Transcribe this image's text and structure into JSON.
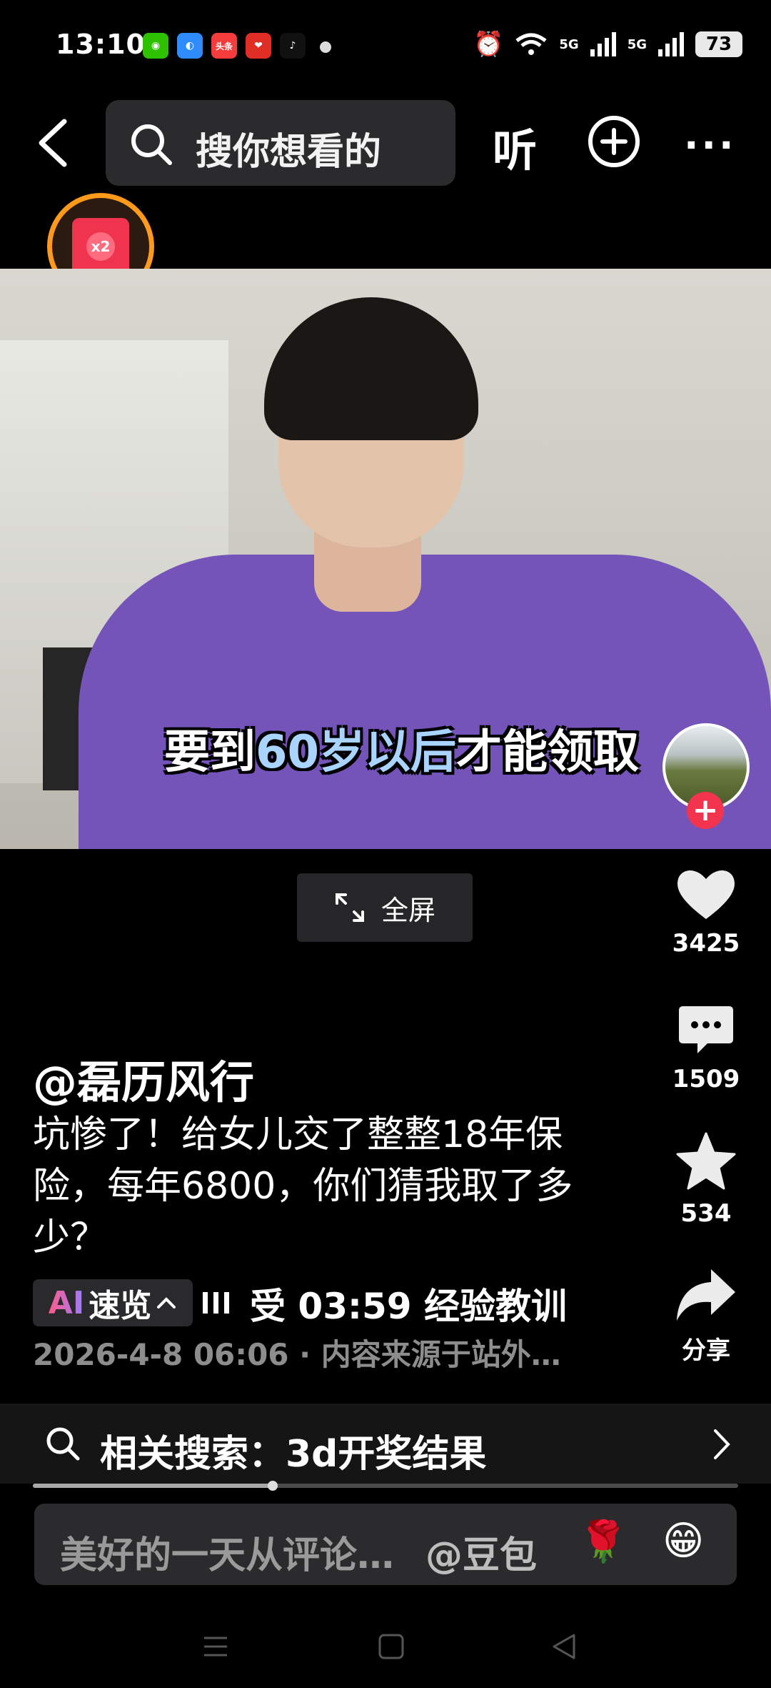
{
  "status_bar": {
    "time": "13:10",
    "apps": [
      {
        "name": "wechat-icon",
        "color": "#2dc100",
        "glyph": "◉"
      },
      {
        "name": "browser-icon",
        "color": "#2f8cff",
        "glyph": "◐"
      },
      {
        "name": "toutiao-icon",
        "color": "#f43c3c",
        "glyph": "头条"
      },
      {
        "name": "pinduoduo-icon",
        "color": "#e02e24",
        "glyph": "❤"
      },
      {
        "name": "tiktok-icon",
        "color": "#111111",
        "glyph": "♪"
      }
    ],
    "network": "5G",
    "battery": "73"
  },
  "top_nav": {
    "search_placeholder": "搜你想看的",
    "listen_label": "听"
  },
  "red_packet": {
    "badge": "x2"
  },
  "video": {
    "caption_prefix": "要到",
    "caption_highlight": "60岁以后",
    "caption_suffix": "才能领取"
  },
  "fullscreen_label": "全屏",
  "actions": {
    "likes": "3425",
    "comments": "1509",
    "favorites": "534",
    "share_label": "分享"
  },
  "post": {
    "author": "@磊历风行",
    "title": "坑惨了！给女儿交了整整18年保险，每年6800，你们猜我取了多少？",
    "ai_label_ai": "AI",
    "ai_label_text": "速览",
    "chapter": "受   03:59 经验教训",
    "date_source": "2026-4-8 06:06 · 内容来源于站外…"
  },
  "related_search": {
    "label": "相关搜索：3d开奖结果",
    "progress": 0.34
  },
  "comment_bar": {
    "placeholder": "美好的一天从评论…",
    "mention": "@豆包",
    "emoji_1": "🌹",
    "emoji_2": "😁"
  },
  "colors": {
    "accent_red": "#f2344f",
    "ring_orange": "#ff9a1a",
    "surface": "#2b2b2d"
  }
}
